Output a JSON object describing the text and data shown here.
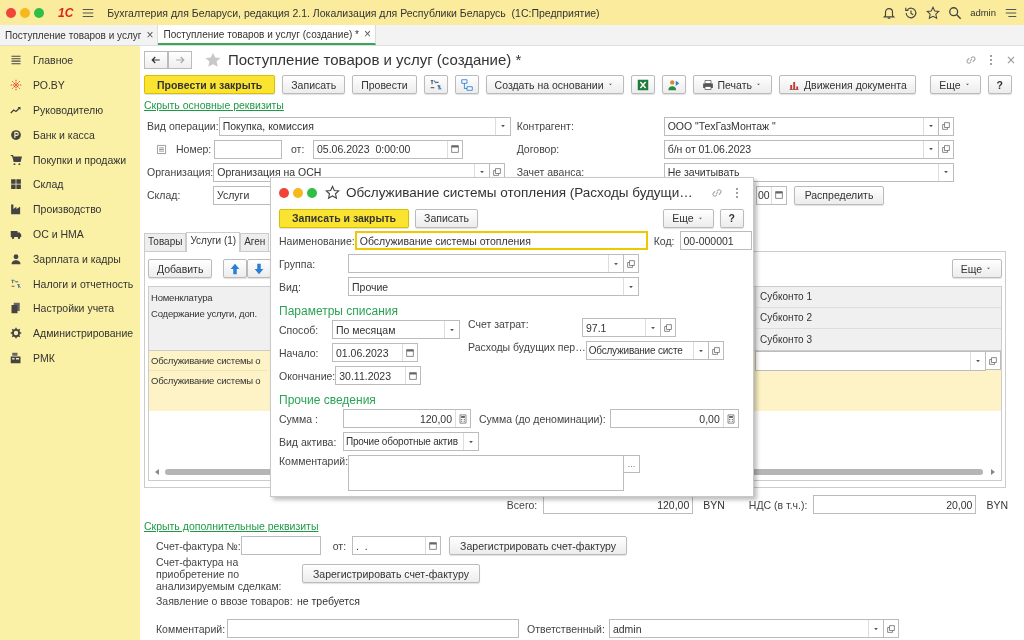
{
  "app": {
    "logo": "1С",
    "title": "Бухгалтерия для Беларуси, редакция 2.1. Локализация для Республики Беларусь  (1С:Предприятие)",
    "user": "admin"
  },
  "open_tabs": [
    {
      "label": "Поступление товаров и услуг",
      "close": "×",
      "selected": false
    },
    {
      "label": "Поступление товаров и услуг (создание) *",
      "close": "×",
      "selected": true
    }
  ],
  "sidebar": {
    "items": [
      {
        "label": "Главное"
      },
      {
        "label": "РО.BY"
      },
      {
        "label": "Руководителю"
      },
      {
        "label": "Банк и касса"
      },
      {
        "label": "Покупки и продажи"
      },
      {
        "label": "Склад"
      },
      {
        "label": "Производство"
      },
      {
        "label": "ОС и НМА"
      },
      {
        "label": "Зарплата и кадры"
      },
      {
        "label": "Налоги и отчетность"
      },
      {
        "label": "Настройки учета"
      },
      {
        "label": "Администрирование"
      },
      {
        "label": "РМК"
      }
    ]
  },
  "document": {
    "title": "Поступление товаров и услуг (создание) *",
    "toolbar": [
      {
        "kind": "primary",
        "label": "Провести и закрыть"
      },
      {
        "kind": "button",
        "label": "Записать"
      },
      {
        "kind": "button",
        "label": "Провести"
      },
      {
        "kind": "icon"
      },
      {
        "kind": "icon"
      },
      {
        "kind": "menu",
        "label": "Создать на основании"
      },
      {
        "kind": "icon"
      },
      {
        "kind": "icon"
      },
      {
        "kind": "menu",
        "label": "Печать"
      },
      {
        "kind": "button",
        "label": "Движения документа"
      }
    ],
    "toolbar_right": [
      {
        "kind": "menu",
        "label": "Еще"
      },
      {
        "kind": "help",
        "label": "?"
      }
    ],
    "hide_link": "Скрыть основные реквизиты",
    "operation": {
      "label": "Вид операции:",
      "value": "Покупка, комиссия"
    },
    "number": {
      "label": "Номер:"
    },
    "date": {
      "label": "от:",
      "value": "05.06.2023  0:00:00"
    },
    "organization": {
      "label": "Организация:",
      "value": "Организация на ОСН"
    },
    "warehouse": {
      "label": "Склад:",
      "value": "Услуги"
    },
    "counterparty": {
      "label": "Контрагент:",
      "value": "ООО \"ТехГазМонтаж \""
    },
    "contract": {
      "label": "Договор:",
      "value": "б/н от 01.06.2023"
    },
    "advance": {
      "label": "Зачет аванса:",
      "value": "Не зачитывать"
    },
    "partial_date": {
      "value": "00"
    },
    "distribute": "Распределить",
    "section_tabs": [
      {
        "label": "Товары",
        "selected": false
      },
      {
        "label": "Услуги (1)",
        "selected": true
      },
      {
        "label": "Аген",
        "selected": false
      }
    ],
    "add_button": "Добавить",
    "table_more": "Еще",
    "table": {
      "header_left": [
        "Номенклатура",
        "Содержание услуги, доп."
      ],
      "header_right": [
        "Субконто 1",
        "Субконто 2",
        "Субконто 3"
      ],
      "rows": [
        {
          "nomenclature": "Обслуживание системы о",
          "content": "Обслуживание системы о",
          "selected": true
        }
      ]
    },
    "total": {
      "label": "Всего:",
      "value": "120,00",
      "currency": "BYN"
    },
    "vat": {
      "label": "НДС (в т.ч.):",
      "value": "20,00",
      "currency": "BYN"
    },
    "hide_extra_link": "Скрыть дополнительные реквизиты",
    "invoice": {
      "label": "Счет-фактура №:",
      "date_label": "от:",
      "date_value": ".  .",
      "button": "Зарегистрировать счет-фактуру"
    },
    "invoice_analyzed": {
      "label": "Счет-фактура на приобретение по анализируемым сделкам:",
      "button": "Зарегистрировать счет-фактуру"
    },
    "import_statement": {
      "label": "Заявление о ввозе товаров:",
      "value": "не требуется"
    },
    "comment": {
      "label": "Комментарий:"
    },
    "responsible": {
      "label": "Ответственный:",
      "value": "admin"
    }
  },
  "dialog": {
    "title": "Обслуживание системы отопления (Расходы будущи…",
    "save_close": "Записать и закрыть",
    "save": "Записать",
    "more": "Еще",
    "help": "?",
    "name": {
      "label": "Наименование:",
      "value": "Обслуживание системы отопления"
    },
    "code": {
      "label": "Код:",
      "value": "00-000001"
    },
    "group": {
      "label": "Группа:"
    },
    "kind": {
      "label": "Вид:",
      "value": "Прочие"
    },
    "section1": "Параметры списания",
    "method": {
      "label": "Способ:",
      "value": "По месяцам"
    },
    "account": {
      "label": "Счет затрат:",
      "value": "97.1"
    },
    "start": {
      "label": "Начало:",
      "value": "01.06.2023"
    },
    "deferred": {
      "label": "Расходы будущих пер…",
      "value": "Обслуживание систе"
    },
    "end": {
      "label": "Окончание:",
      "value": "30.11.2023"
    },
    "section2": "Прочие сведения",
    "sum": {
      "label": "Сумма :",
      "value": "120,00"
    },
    "sum_old": {
      "label": "Сумма (до деноминации):",
      "value": "0,00"
    },
    "asset": {
      "label": "Вид актива:",
      "value": "Прочие оборотные актив"
    },
    "comment": {
      "label": "Комментарий:",
      "button": "..."
    }
  }
}
